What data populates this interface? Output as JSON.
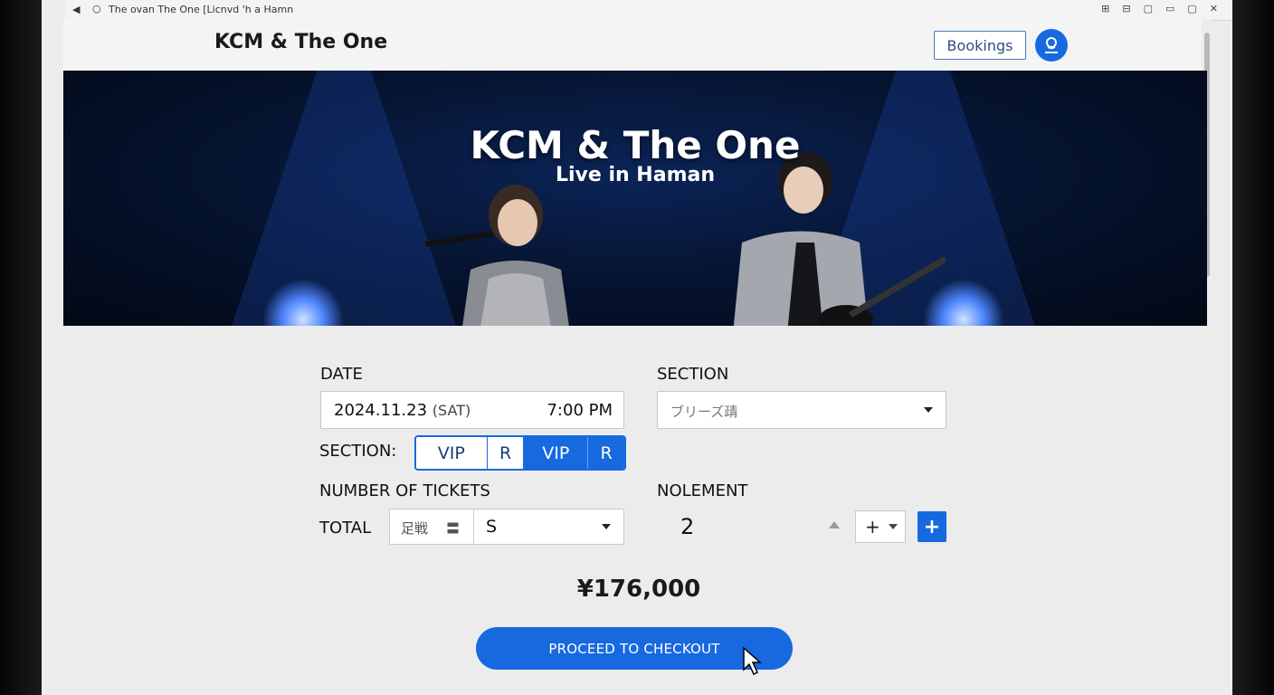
{
  "window": {
    "title": "The ovan   The One  [Licnvd 'h a Hamn",
    "back_icon": "◀",
    "reload_icon": "○",
    "controls": [
      "⊞",
      "⊟",
      "▢",
      "▭",
      "▢",
      "✕"
    ]
  },
  "header": {
    "brand": "KCM & The One",
    "bookings_label": "Bookings"
  },
  "hero": {
    "title": "KCM & The One",
    "subtitle": "Live in Haman"
  },
  "form": {
    "date_label": "DATE",
    "date_value": "2024.11.23",
    "date_day": "(SAT)",
    "time_value": "7:00 PM",
    "section_label": "SECTION",
    "section_placeholder": "ブリーズ靕",
    "section_toggle_label": "SECTION:",
    "section_options": [
      "VIP",
      "R",
      "VIP",
      "R"
    ],
    "tickets_label": "NUMBER OF TICKETS",
    "total_label": "TOTAL",
    "total_prefix": "足戦",
    "total_icon": "〓",
    "total_value": "S",
    "nolement_label": "NOLEMENT",
    "quantity": "2",
    "stepper_symbol": "+",
    "add_symbol": "+"
  },
  "price": "¥176,000",
  "checkout_label": "PROCEED TO CHECKOUT",
  "colors": {
    "accent": "#1769e0",
    "hero_bg": "#061533"
  }
}
